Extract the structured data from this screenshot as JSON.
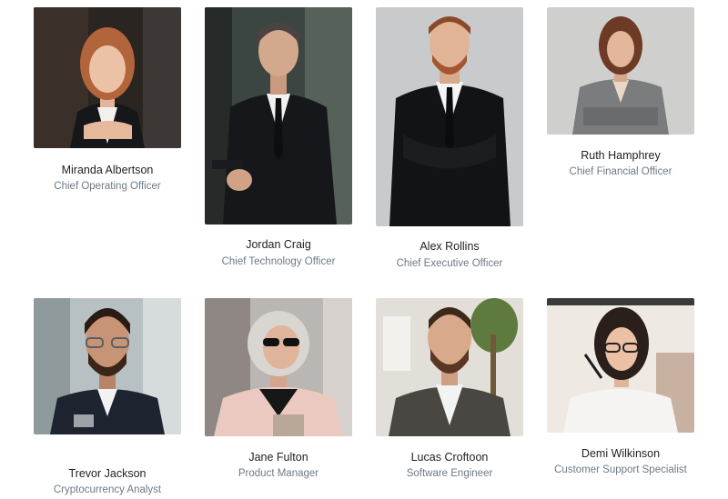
{
  "team": [
    {
      "name": "Miranda Albertson",
      "role": "Chief Operating Officer",
      "photo": "portrait-woman-red-hair-black-blazer"
    },
    {
      "name": "Jordan Craig",
      "role": "Chief Technology Officer",
      "photo": "portrait-man-suit-phone"
    },
    {
      "name": "Alex Rollins",
      "role": "Chief Executive Officer",
      "photo": "portrait-man-suit-arms-crossed"
    },
    {
      "name": "Ruth Hamphrey",
      "role": "Chief Financial Officer",
      "photo": "portrait-woman-gray-blazer"
    },
    {
      "name": "Trevor Jackson",
      "role": "Cryptocurrency Analyst",
      "photo": "portrait-man-beard-glasses"
    },
    {
      "name": "Jane Fulton",
      "role": "Product Manager",
      "photo": "portrait-woman-gray-hair-sunglasses"
    },
    {
      "name": "Lucas Croftoon",
      "role": "Software Engineer",
      "photo": "portrait-man-beard-brown-jacket"
    },
    {
      "name": "Demi Wilkinson",
      "role": "Customer Support Specialist",
      "photo": "portrait-woman-glasses-white-top"
    }
  ]
}
